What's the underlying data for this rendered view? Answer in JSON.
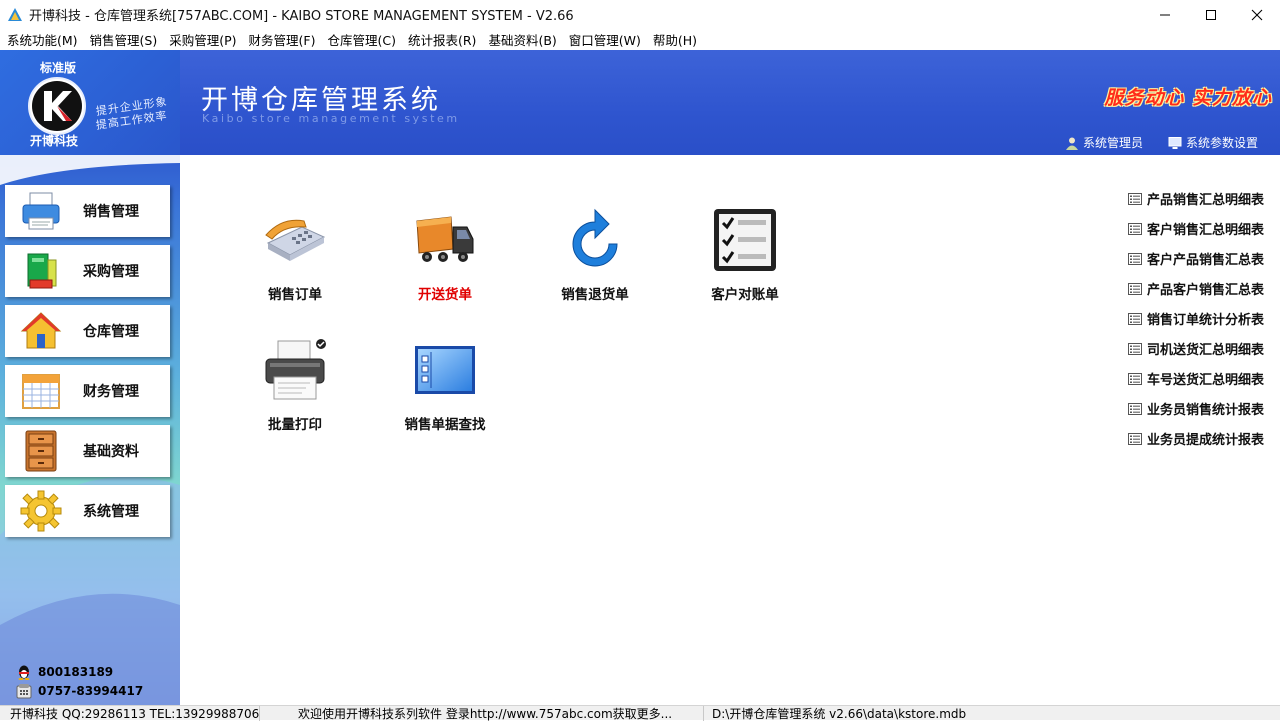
{
  "window": {
    "title": "开博科技 - 仓库管理系统[757ABC.COM] - KAIBO STORE MANAGEMENT SYSTEM - V2.66"
  },
  "menu": [
    "系统功能(M)",
    "销售管理(S)",
    "采购管理(P)",
    "财务管理(F)",
    "仓库管理(C)",
    "统计报表(R)",
    "基础资料(B)",
    "窗口管理(W)",
    "帮助(H)"
  ],
  "header": {
    "edition": "标准版",
    "company": "开博科技",
    "slogan_line1": "提升企业形象",
    "slogan_line2": "提高工作效率",
    "title": "开博仓库管理系统",
    "subtitle": "Kaibo store management system",
    "motto": "服务动心 实力放心",
    "user_link": "系统管理员",
    "settings_link": "系统参数设置"
  },
  "sidebar": {
    "items": [
      {
        "label": "销售管理",
        "icon": "printer-icon"
      },
      {
        "label": "采购管理",
        "icon": "books-icon"
      },
      {
        "label": "仓库管理",
        "icon": "house-icon"
      },
      {
        "label": "财务管理",
        "icon": "calendar-icon"
      },
      {
        "label": "基础资料",
        "icon": "cabinet-icon"
      },
      {
        "label": "系统管理",
        "icon": "gear-icon"
      }
    ],
    "qq": "800183189",
    "phone": "0757-83994417"
  },
  "tiles": [
    {
      "label": "销售订单",
      "icon": "telephone-icon",
      "highlight": false
    },
    {
      "label": "开送货单",
      "icon": "truck-icon",
      "highlight": true
    },
    {
      "label": "销售退货单",
      "icon": "refresh-arrow-icon",
      "highlight": false
    },
    {
      "label": "客户对账单",
      "icon": "checklist-icon",
      "highlight": false
    },
    {
      "label": "批量打印",
      "icon": "printer-icon",
      "highlight": false
    },
    {
      "label": "销售单据查找",
      "icon": "window-list-icon",
      "highlight": false
    }
  ],
  "reports": [
    "产品销售汇总明细表",
    "客户销售汇总明细表",
    "客户产品销售汇总表",
    "产品客户销售汇总表",
    "销售订单统计分析表",
    "司机送货汇总明细表",
    "车号送货汇总明细表",
    "业务员销售统计报表",
    "业务员提成统计报表"
  ],
  "status": {
    "left": "开博科技 QQ:29286113 TEL:13929988706",
    "middle": "欢迎使用开博科技系列软件   登录http://www.757abc.com获取更多...",
    "right": "D:\\开博仓库管理系统 v2.66\\data\\kstore.mdb"
  },
  "colors": {
    "banner": "#2f55cf",
    "motto": "#ff2b1a",
    "highlight_label": "#e00000"
  }
}
